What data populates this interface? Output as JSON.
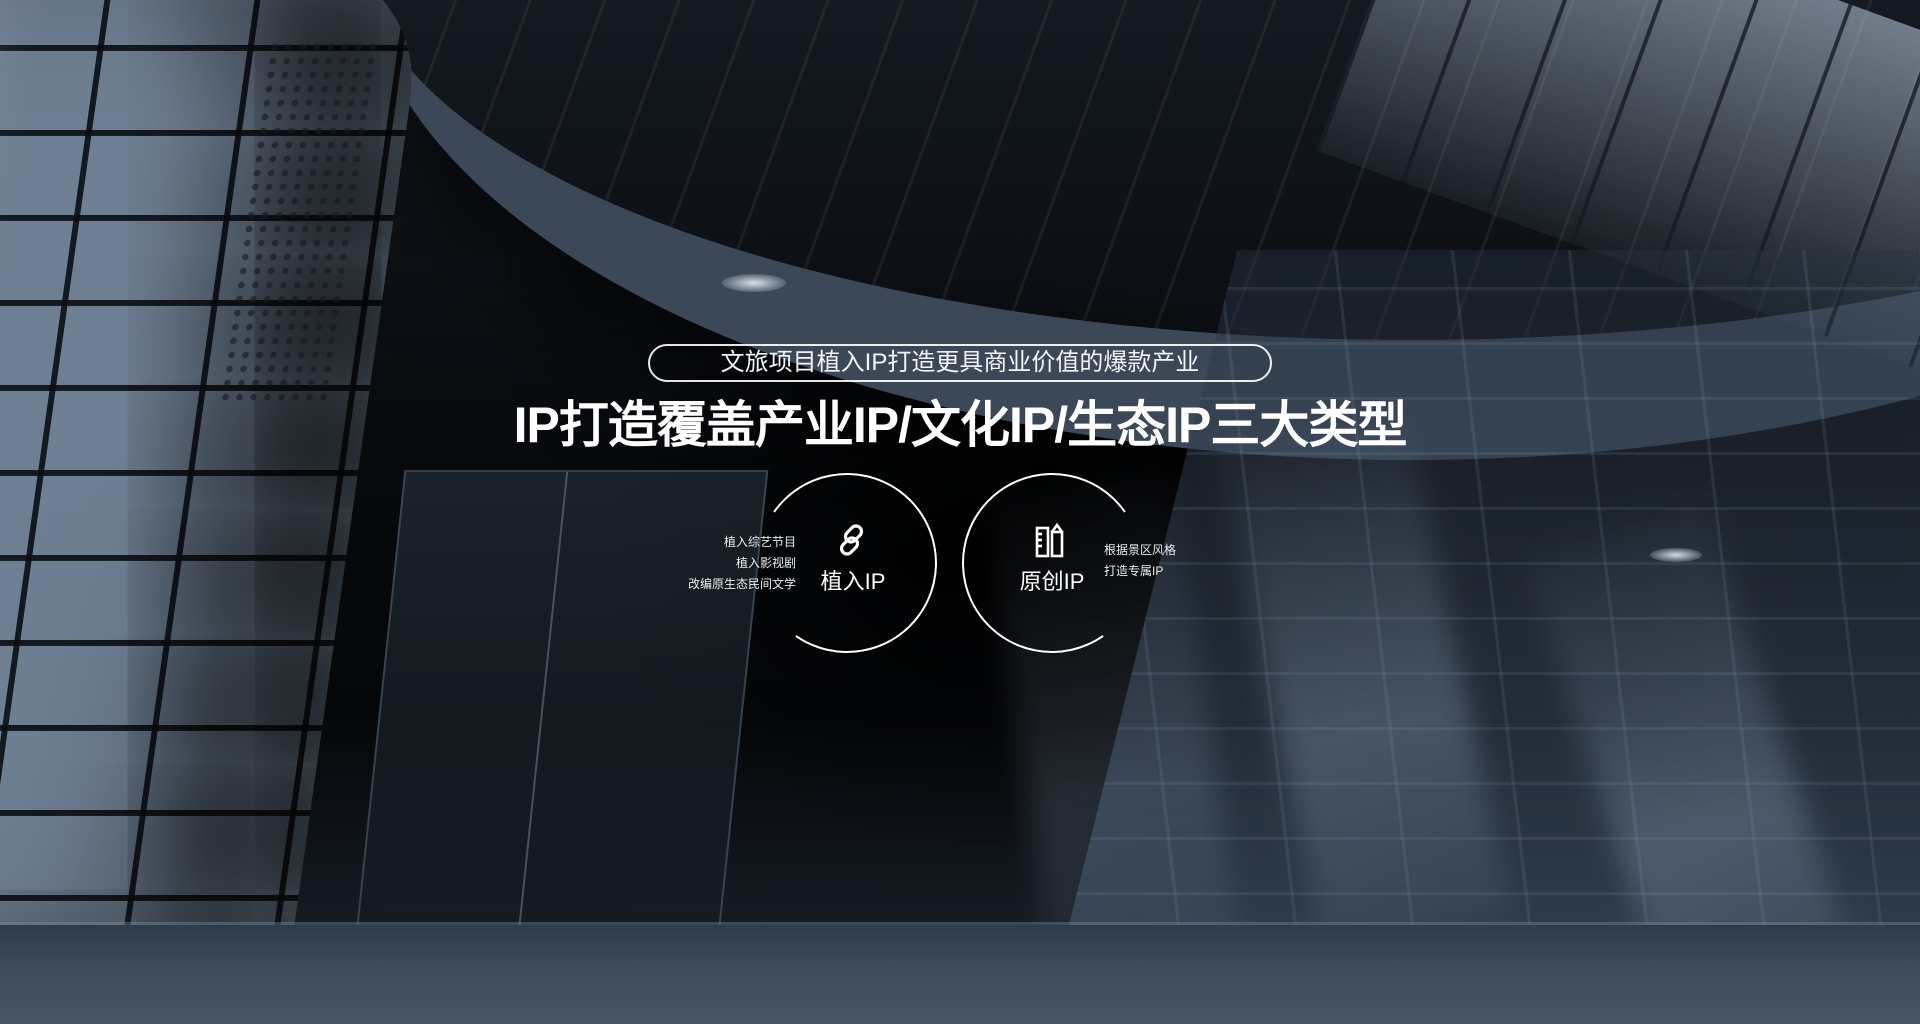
{
  "banner": {
    "tagline": "文旅项目植入IP打造更具商业价值的爆款产业",
    "headline": "IP打造覆盖产业IP/文化IP/生态IP三大类型"
  },
  "types": [
    {
      "icon": "link-icon",
      "label": "植入IP",
      "details": [
        "植入综艺节目",
        "植入影视剧",
        "改编原生态民间文学"
      ]
    },
    {
      "icon": "ruler-pencil-icon",
      "label": "原创IP",
      "details": [
        "根据景区风格",
        "打造专属IP"
      ]
    }
  ],
  "colors": {
    "text": "#ffffff",
    "background": "#07090c"
  }
}
